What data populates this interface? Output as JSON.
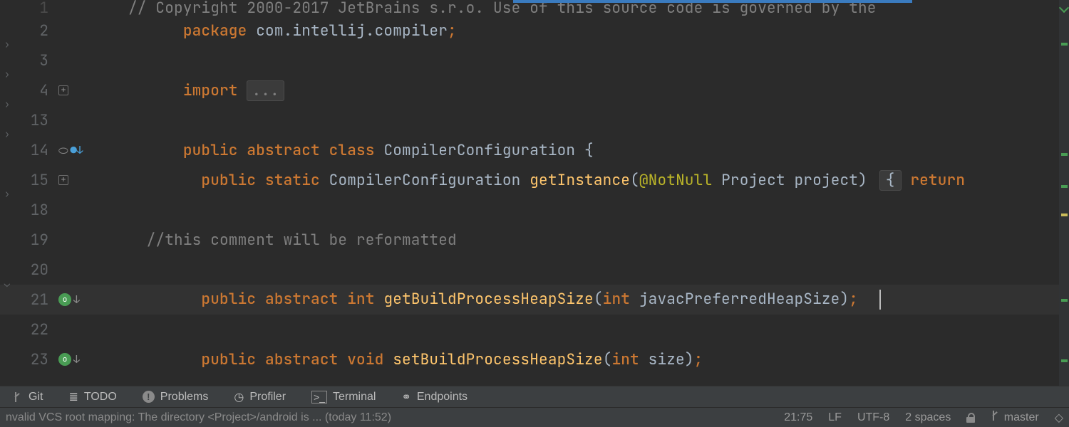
{
  "code": {
    "line1_comment": "// Copyright 2000-2017 JetBrains s.r.o. Use of this source code is governed by the",
    "line2_tokens": {
      "kw1": "package",
      "pkg": " com.intellij.compiler",
      "semi": ";"
    },
    "line4_tokens": {
      "kw": "import",
      "rest": " ",
      "ellipsis": "..."
    },
    "line14": {
      "pub": "public ",
      "abs": "abstract ",
      "cls": "class ",
      "name": "CompilerConfiguration ",
      "brace": "{"
    },
    "line15": {
      "indent": "  ",
      "pub": "public ",
      "stat": "static ",
      "type": "CompilerConfiguration ",
      "meth": "getInstance",
      "lp": "(",
      "ann": "@NotNull",
      "sp": " ",
      "ptype": "Project ",
      "pname": "project",
      "rp": ") ",
      "foldbrace": "{",
      "ret": " return"
    },
    "line19": {
      "cmt": "//this comment will be reformatted"
    },
    "line21": {
      "pub": "public ",
      "abs": "abstract ",
      "ret": "int ",
      "meth": "getBuildProcessHeapSize",
      "lp": "(",
      "ptype": "int ",
      "pname": "javacPreferredHeapSize",
      "rp": ")",
      "semi": ";"
    },
    "line23": {
      "pub": "public ",
      "abs": "abstract ",
      "ret": "void ",
      "meth": "setBuildProcessHeapSize",
      "lp": "(",
      "ptype": "int ",
      "pname": "size",
      "rp": ")",
      "semi": ";"
    }
  },
  "gutter": {
    "lines": [
      "1",
      "2",
      "3",
      "4",
      "13",
      "14",
      "15",
      "18",
      "19",
      "20",
      "21",
      "22",
      "23"
    ]
  },
  "toolbar": {
    "git": "Git",
    "todo": "TODO",
    "problems": "Problems",
    "profiler": "Profiler",
    "terminal": "Terminal",
    "endpoints": "Endpoints"
  },
  "status": {
    "left": "nvalid VCS root mapping: The directory <Project>/android is ... (today 11:52)",
    "pos": "21:75",
    "sep": "LF",
    "enc": "UTF-8",
    "indent": "2 spaces",
    "branch": "master"
  }
}
